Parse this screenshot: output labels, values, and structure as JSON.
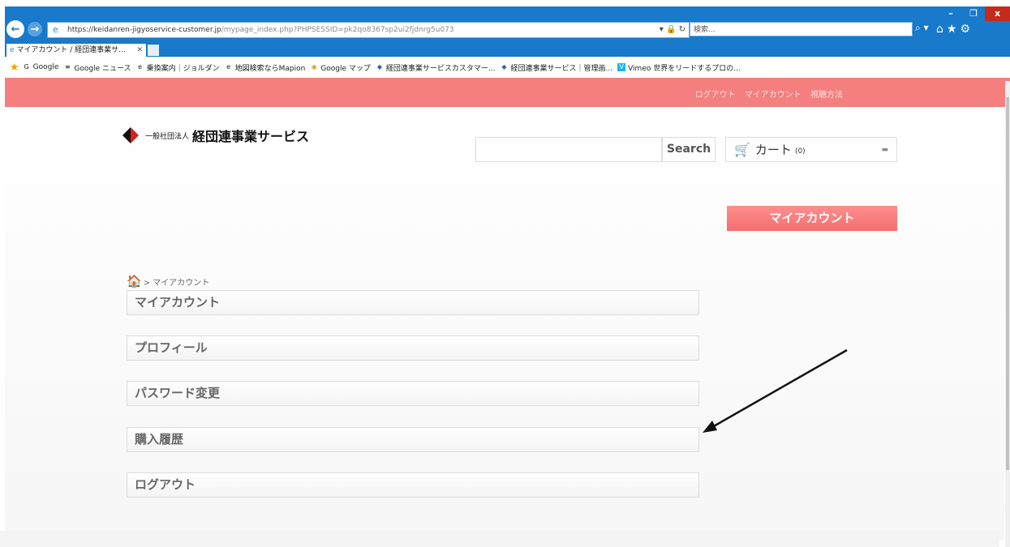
{
  "browser": {
    "url_main": "https://keidanren-jigyoservice-customer.jp",
    "url_rest": "/mypage_index.php?PHPSESSID=pk2qo8367sp2ui2fjdnrg5u073",
    "search_placeholder": "検索...",
    "tab_title": "マイアカウント / 経団連事業サ...",
    "favorites": [
      {
        "label": "Google",
        "icon": "G"
      },
      {
        "label": "Google ニュース",
        "icon": "≡"
      },
      {
        "label": "乗換案内｜ジョルダン",
        "icon": "e"
      },
      {
        "label": "地図検索ならMapion",
        "icon": "e"
      },
      {
        "label": "Google マップ",
        "icon": "◉"
      },
      {
        "label": "経団連事業サービスカスタマー...",
        "icon": "◆"
      },
      {
        "label": "経団連事業サービス｜管理画...",
        "icon": "◆"
      },
      {
        "label": "Vimeo 世界をリードするプロの...",
        "icon": "V"
      }
    ]
  },
  "site": {
    "top_links": [
      "ログアウト",
      "マイアカウント",
      "視聴方法"
    ],
    "logo_small": "一般社団法人",
    "logo_big": "経団連事業サービス",
    "search_button": "Search",
    "cart_label": "カート",
    "cart_count": "(0)",
    "my_account_button": "マイアカウント",
    "breadcrumb": "> マイアカウント",
    "menu": [
      "マイアカウント",
      "プロフィール",
      "パスワード変更",
      "購入履歴",
      "ログアウト"
    ]
  },
  "colors": {
    "browser_chrome": "#1979ca",
    "accent_pink": "#f57f7f"
  }
}
